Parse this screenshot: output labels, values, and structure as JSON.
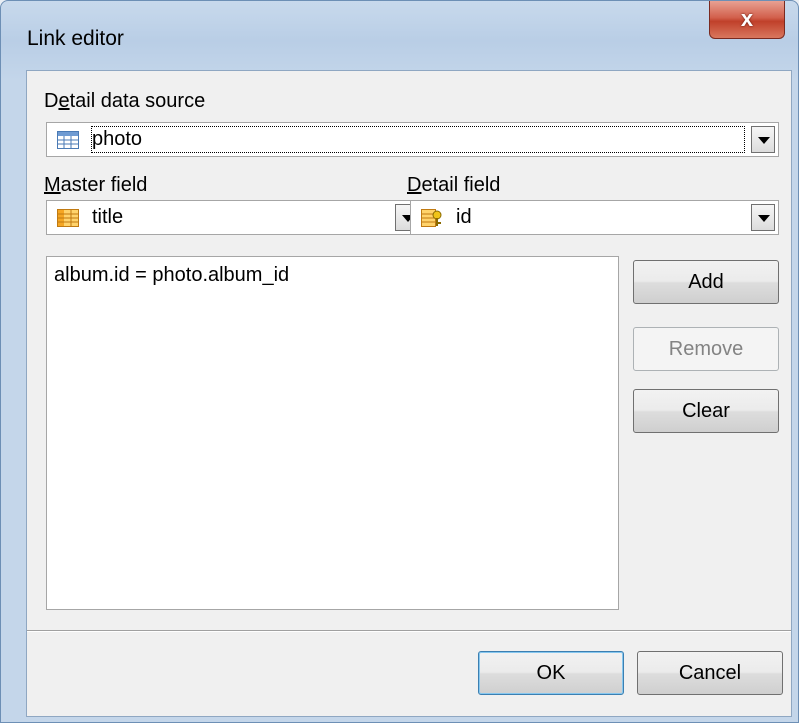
{
  "window": {
    "title": "Link editor",
    "close_label": "x"
  },
  "detail_data_source": {
    "label_prefix": "D",
    "label_underlined": "e",
    "label_rest": "tail data source",
    "value": "photo",
    "icon": "table-icon"
  },
  "master_field": {
    "label_underlined": "M",
    "label_rest": "aster field",
    "value": "title",
    "icon": "field-list-icon"
  },
  "detail_field": {
    "label_underlined": "D",
    "label_rest": "etail field",
    "value": "id",
    "icon": "key-field-icon"
  },
  "links": [
    "album.id = photo.album_id"
  ],
  "buttons": {
    "add": "Add",
    "remove": "Remove",
    "clear": "Clear",
    "ok": "OK",
    "cancel": "Cancel"
  },
  "colors": {
    "close_button": "#c0402a",
    "window_frame": "#b9cee6",
    "client_bg": "#f0f0f0"
  }
}
